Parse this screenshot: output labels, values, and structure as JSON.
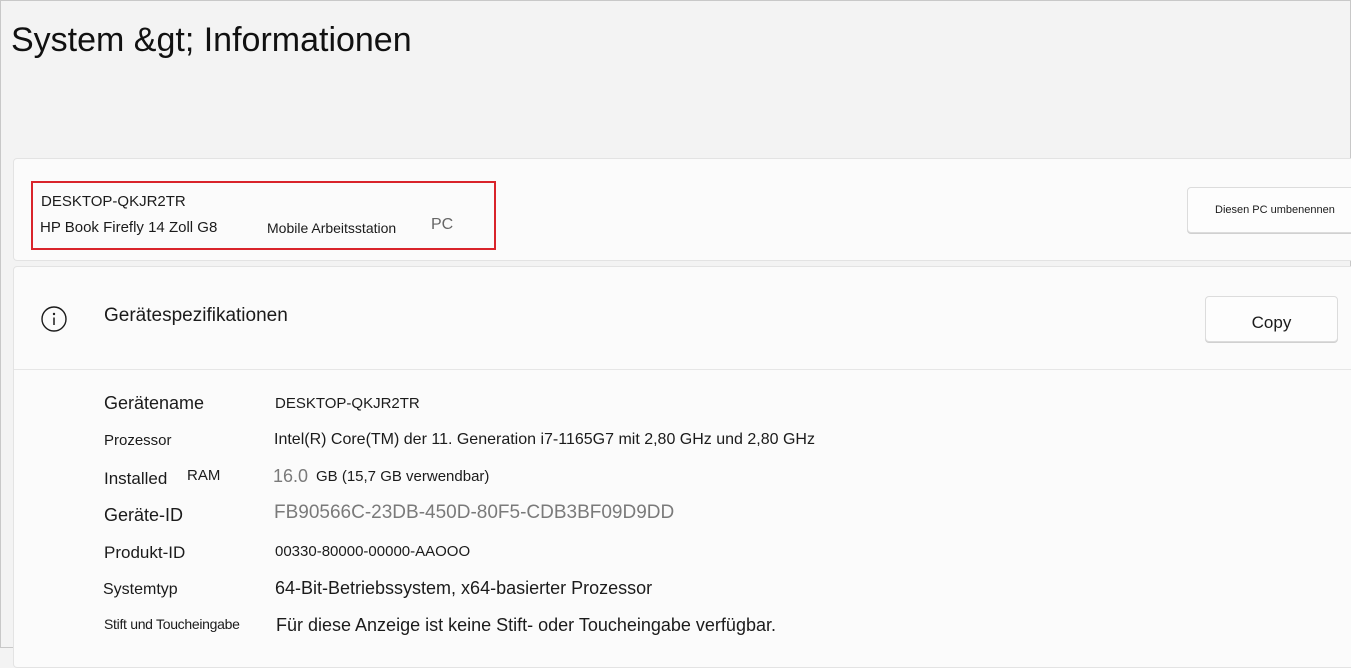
{
  "page": {
    "title": "System &gt;  Informationen"
  },
  "pc_card": {
    "device_name": "DESKTOP-QKJR2TR",
    "model": "HP Book Firefly 14 Zoll G8",
    "type": "Mobile Arbeitsstation",
    "kind": "PC",
    "rename_button": "Diesen PC umbenennen",
    "highlight_color": "#d9242b"
  },
  "spec_card": {
    "icon": "info-icon",
    "title": "Gerätespezifikationen",
    "copy_button": "Copy",
    "rows": [
      {
        "label": "Gerätename",
        "value": "DESKTOP-QKJR2TR"
      },
      {
        "label": "Prozessor",
        "value": "Intel(R) Core(TM) der 11. Generation i7-1165G7 mit 2,80 GHz und 2,80 GHz"
      },
      {
        "label_a": "Installed",
        "label_b": "RAM",
        "value_a": "16.0",
        "value_b": "GB (15,7 GB verwendbar)"
      },
      {
        "label": "Geräte-ID",
        "value": "FB90566C-23DB-450D-80F5-CDB3BF09D9DD"
      },
      {
        "label": "Produkt-ID",
        "value": "00330-80000-00000-AAOOO"
      },
      {
        "label": "Systemtyp",
        "value": "64-Bit-Betriebssystem, x64-basierter Prozessor"
      },
      {
        "label": "Stift und Toucheingabe",
        "value": "Für diese Anzeige ist keine Stift- oder Toucheingabe verfügbar."
      }
    ]
  }
}
